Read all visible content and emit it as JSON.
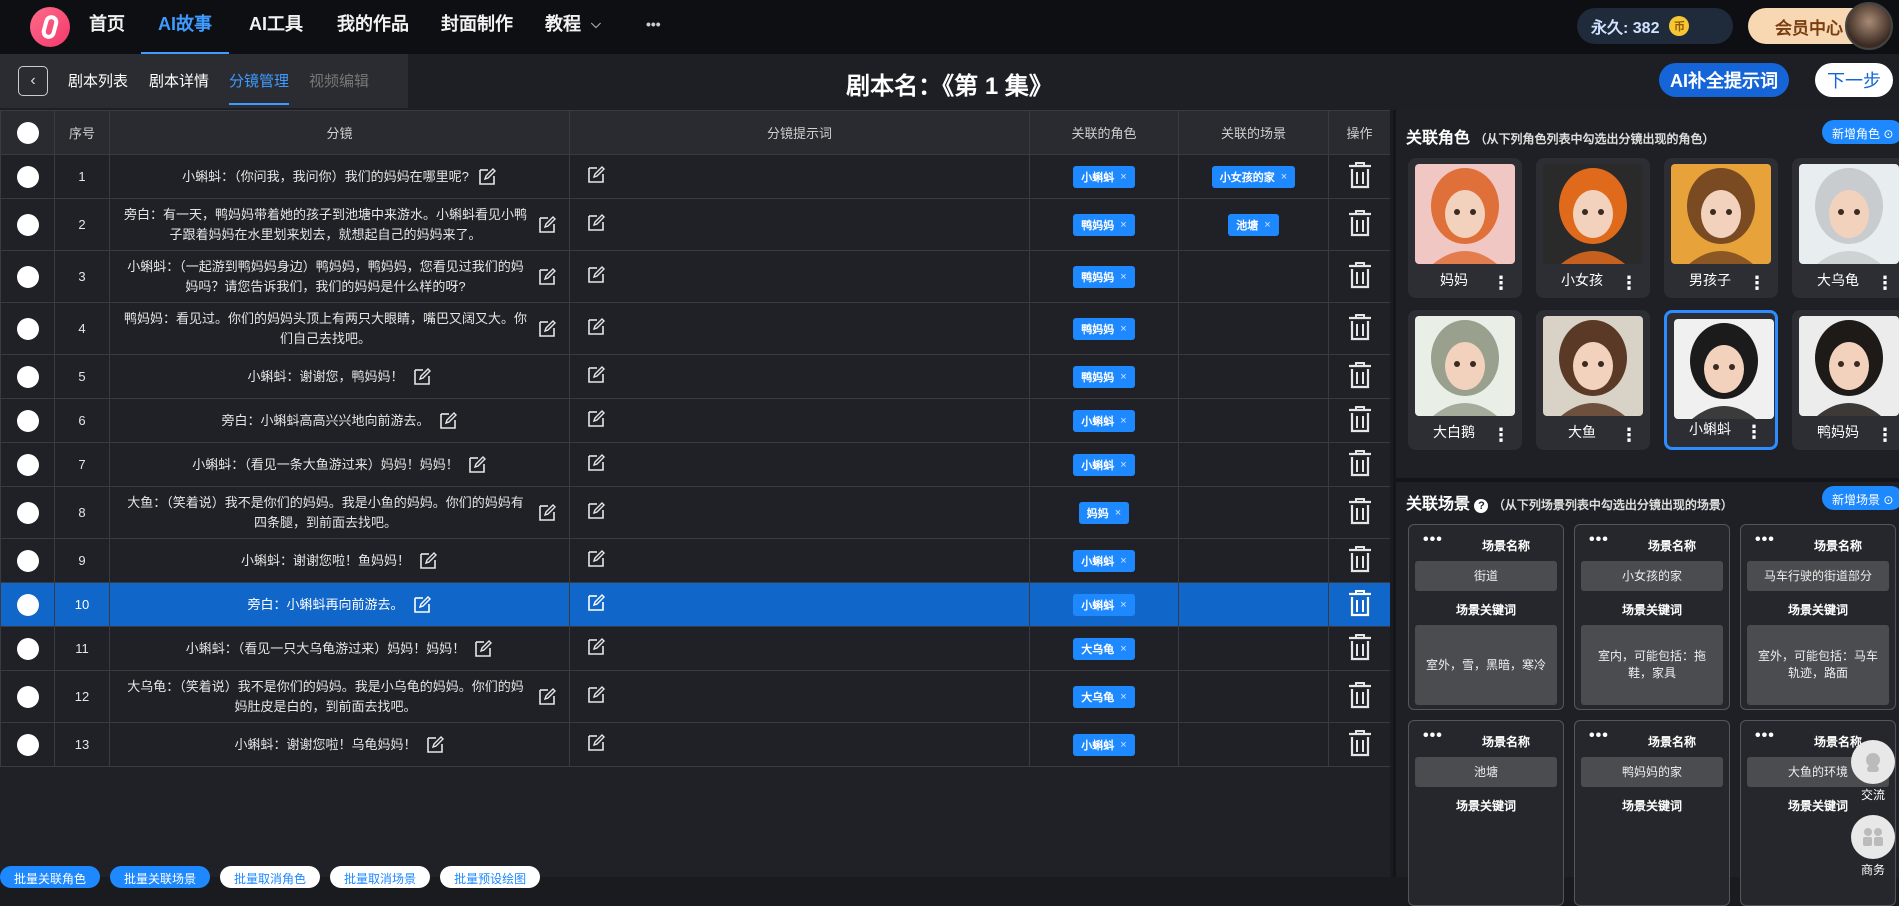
{
  "nav": {
    "items": [
      "首页",
      "AI故事",
      "AI工具",
      "我的作品",
      "封面制作",
      "教程"
    ],
    "active_index": 1,
    "more": "•••",
    "coins_label": "永久: 382",
    "coin_symbol": "币",
    "vip_label": "会员中心"
  },
  "subnav": {
    "back": "‹",
    "tabs": [
      "剧本列表",
      "剧本详情",
      "分镜管理",
      "视频编辑"
    ],
    "active_index": 2,
    "disabled_index": 3,
    "script_title": "剧本名：《第 1 集》",
    "ai_button": "AI补全提示词",
    "next_button": "下一步"
  },
  "table": {
    "headers": [
      "序号",
      "分镜",
      "分镜提示词",
      "关联的角色",
      "关联的场景",
      "操作"
    ],
    "selected_row": 10,
    "rows": [
      {
        "no": "1",
        "text": "小蝌蚪：（你问我，我问你）我们的妈妈在哪里呢?",
        "role": "小蝌蚪",
        "scene": "小女孩的家"
      },
      {
        "no": "2",
        "text": "旁白：有一天，鸭妈妈带着她的孩子到池塘中来游水。小蝌蚪看见小鸭子跟着妈妈在水里划来划去，就想起自己的妈妈来了。",
        "role": "鸭妈妈",
        "scene": "池塘"
      },
      {
        "no": "3",
        "text": "小蝌蚪：（一起游到鸭妈妈身边）鸭妈妈，鸭妈妈，您看见过我们的妈妈吗？请您告诉我们，我们的妈妈是什么样的呀?",
        "role": "鸭妈妈",
        "scene": ""
      },
      {
        "no": "4",
        "text": "鸭妈妈：看见过。你们的妈妈头顶上有两只大眼睛，嘴巴又阔又大。你们自己去找吧。",
        "role": "鸭妈妈",
        "scene": ""
      },
      {
        "no": "5",
        "text": "小蝌蚪：谢谢您，鸭妈妈！",
        "role": "鸭妈妈",
        "scene": ""
      },
      {
        "no": "6",
        "text": "旁白：小蝌蚪高高兴兴地向前游去。",
        "role": "小蝌蚪",
        "scene": ""
      },
      {
        "no": "7",
        "text": "小蝌蚪：（看见一条大鱼游过来）妈妈！妈妈！",
        "role": "小蝌蚪",
        "scene": ""
      },
      {
        "no": "8",
        "text": "大鱼：（笑着说）我不是你们的妈妈。我是小鱼的妈妈。你们的妈妈有四条腿，到前面去找吧。",
        "role": "妈妈",
        "scene": ""
      },
      {
        "no": "9",
        "text": "小蝌蚪：谢谢您啦！鱼妈妈！",
        "role": "小蝌蚪",
        "scene": ""
      },
      {
        "no": "10",
        "text": "旁白：小蝌蚪再向前游去。",
        "role": "小蝌蚪",
        "scene": ""
      },
      {
        "no": "11",
        "text": "小蝌蚪：（看见一只大乌龟游过来）妈妈！妈妈！",
        "role": "大乌龟",
        "scene": ""
      },
      {
        "no": "12",
        "text": "大乌龟：（笑着说）我不是你们的妈妈。我是小乌龟的妈妈。你们的妈妈肚皮是白的，到前面去找吧。",
        "role": "大乌龟",
        "scene": ""
      },
      {
        "no": "13",
        "text": "小蝌蚪：谢谢您啦！乌龟妈妈！",
        "role": "小蝌蚪",
        "scene": ""
      }
    ],
    "tag_close": "×"
  },
  "bottom_buttons": [
    "批量关联角色",
    "批量关联场景",
    "批量取消角色",
    "批量取消场景",
    "批量预设绘图"
  ],
  "characters_panel": {
    "title": "关联角色",
    "subtitle": "（从下列角色列表中勾选出分镜出现的角色）",
    "add_button": "新增角色 ⊙",
    "selected_index": 6,
    "items": [
      {
        "name": "妈妈",
        "hair": "#e0703a",
        "bg": "#f1c7c4"
      },
      {
        "name": "小女孩",
        "hair": "#e06a1c",
        "bg": "#2a2a2a"
      },
      {
        "name": "男孩子",
        "hair": "#7a4a22",
        "bg": "#e7a33a"
      },
      {
        "name": "大乌龟",
        "hair": "#c9cccf",
        "bg": "#e8eef0"
      },
      {
        "name": "大白鹅",
        "hair": "#9aa08e",
        "bg": "#e9efe6"
      },
      {
        "name": "大鱼",
        "hair": "#5a3a26",
        "bg": "#d9d2c6"
      },
      {
        "name": "小蝌蚪",
        "hair": "#1b1b1b",
        "bg": "#f0f0f0"
      },
      {
        "name": "鸭妈妈",
        "hair": "#1e1a18",
        "bg": "#ececec"
      }
    ],
    "more": "⋮"
  },
  "scenes_panel": {
    "title": "关联场景",
    "subtitle": "（从下列场景列表中勾选出分镜出现的场景）",
    "add_button": "新增场景 ⊙",
    "name_label": "场景名称",
    "keyword_label": "场景关键词",
    "more": "•••",
    "items": [
      {
        "name": "街道",
        "keywords": "室外，雪，黑暗，寒冷"
      },
      {
        "name": "小女孩的家",
        "keywords": "室内，可能包括：拖鞋，家具"
      },
      {
        "name": "马车行驶的街道部分",
        "keywords": "室外，可能包括：马车轨迹，路面"
      },
      {
        "name": "池塘",
        "keywords": ""
      },
      {
        "name": "鸭妈妈的家",
        "keywords": ""
      },
      {
        "name": "大鱼的环境",
        "keywords": ""
      }
    ]
  },
  "float": {
    "chat": "交流",
    "business": "商务"
  },
  "colors": {
    "accent": "#1e88ff",
    "selected_row": "#1167c9",
    "vip": "#f8d7b3"
  }
}
